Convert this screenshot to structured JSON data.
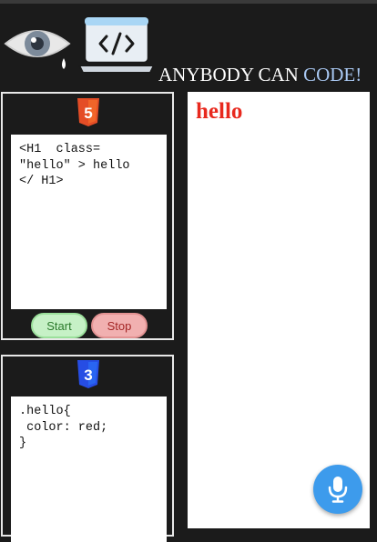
{
  "header": {
    "title_main": "ANYBODY CAN ",
    "title_accent": "CODE!",
    "icons": [
      "eye-icon",
      "laptop-code-icon"
    ]
  },
  "html_panel": {
    "badge": "html5-icon",
    "code": "<H1  class=\n\"hello\" > hello\n</ H1>",
    "start_label": "Start",
    "stop_label": "Stop"
  },
  "css_panel": {
    "badge": "css3-icon",
    "code": ".hello{\n color: red;\n}"
  },
  "preview": {
    "heading": "hello"
  },
  "mic": {
    "icon": "microphone-icon"
  },
  "colors": {
    "background": "#1b1b1b",
    "accent_blue": "#a9c8f2",
    "heading_red": "#e8291e",
    "start_green": "#c6f1c6",
    "stop_red": "#f1b0b0",
    "mic_blue": "#3d9bec",
    "html5_orange": "#e44d26",
    "css3_blue": "#264de4"
  }
}
